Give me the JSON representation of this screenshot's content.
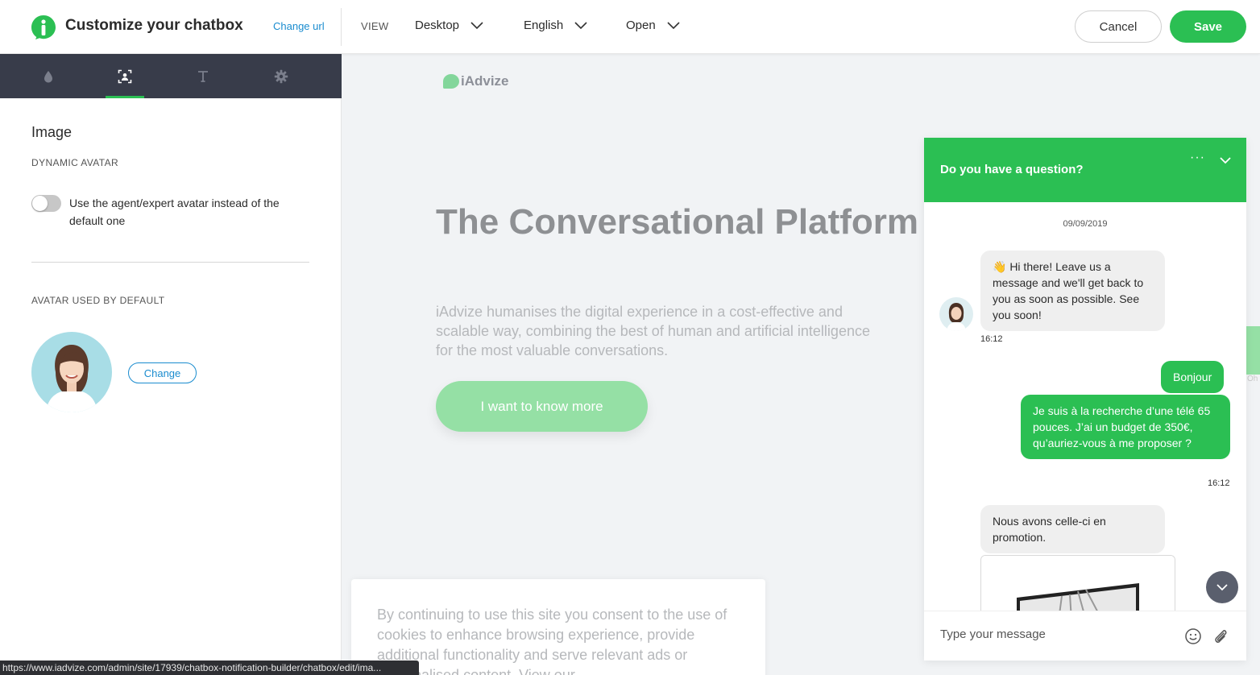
{
  "header": {
    "title": "Customize your chatbox",
    "change_url": "Change url",
    "view_label": "VIEW",
    "device": "Desktop",
    "language": "English",
    "state": "Open",
    "cancel": "Cancel",
    "save": "Save"
  },
  "colors": {
    "accent": "#2bbf53",
    "link": "#1a8ccf",
    "tabbar": "#383c4a"
  },
  "left_panel": {
    "tabs": [
      {
        "icon": "droplet-icon",
        "active": false
      },
      {
        "icon": "avatar-frame-icon",
        "active": true
      },
      {
        "icon": "text-icon",
        "active": false
      },
      {
        "icon": "gear-icon",
        "active": false
      }
    ],
    "section_title": "Image",
    "dynamic_avatar_label": "DYNAMIC AVATAR",
    "toggle_text": "Use the agent/expert avatar instead of the default one",
    "toggle_on": false,
    "avatar_default_label": "AVATAR USED BY DEFAULT",
    "change_button": "Change"
  },
  "preview": {
    "site_logo": "iAdvize",
    "hero_title": "The Conversational Platform",
    "hero_text": "iAdvize humanises the digital experience in a cost-effective and scalable way, combining the best of human and artificial intelligence for the most valuable conversations.",
    "hero_button": "I want to know more",
    "cookie_text": "By continuing to use this site you consent to the use of cookies to enhance browsing experience, provide additional functionality and serve relevant ads or personalised content. View our",
    "side_small": "Oh"
  },
  "chat": {
    "header_title": "Do you have a question?",
    "more": "···",
    "date": "09/09/2019",
    "messages": [
      {
        "from": "agent",
        "text": "👋 Hi there! Leave us a message and we'll get back to you as soon as possible. See you soon!",
        "time": "16:12"
      },
      {
        "from": "visitor",
        "text": "Bonjour"
      },
      {
        "from": "visitor",
        "text": "Je suis à la recherche d’une télé 65 pouces. J’ai un budget de 350€, qu’auriez-vous à me proposer ?",
        "time": "16:12"
      },
      {
        "from": "agent",
        "text": "Nous avons celle-ci en promotion."
      }
    ],
    "input_placeholder": "Type your message"
  },
  "status_url": "https://www.iadvize.com/admin/site/17939/chatbox-notification-builder/chatbox/edit/ima..."
}
